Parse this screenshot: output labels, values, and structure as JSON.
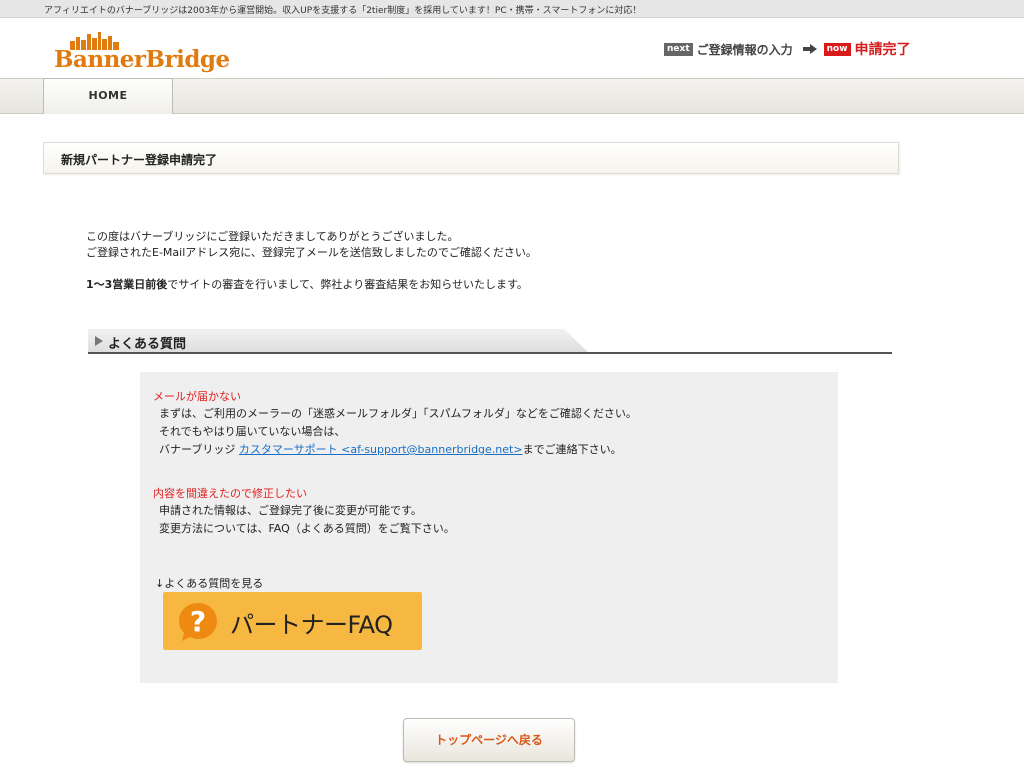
{
  "topbar": {
    "notice": "アフィリエイトのバナーブリッジは2003年から運営開始。収入UPを支援する「2tier制度」を採用しています！PC・携帯・スマートフォンに対応！"
  },
  "header": {
    "logo_text": "BannerBridge",
    "steps": {
      "next_badge": "next",
      "next_label": "ご登録情報の入力",
      "now_badge": "now",
      "now_label": "申請完了"
    }
  },
  "nav": {
    "home": "HOME"
  },
  "page": {
    "title": "新規パートナー登録申請完了"
  },
  "intro": {
    "line1": "この度はバナーブリッジにご登録いただきましてありがとうございました。",
    "line2": "ご登録されたE-Mailアドレス宛に、登録完了メールを送信致しましたのでご確認ください。",
    "notice_bold": "1～3営業日前後",
    "notice_rest": "でサイトの審査を行いまして、弊社より審査結果をお知らせいたします。"
  },
  "faq": {
    "heading": "よくある質問",
    "items": [
      {
        "question": "メールが届かない",
        "answer1": "まずは、ご利用のメーラーの「迷惑メールフォルダ」「スパムフォルダ」などをご確認ください。",
        "answer2": "それでもやはり届いていない場合は、",
        "answer3_pre": "バナーブリッジ ",
        "answer3_link": "カスタマーサポート <af-support@bannerbridge.net>",
        "answer3_post": "までご連絡下さい。"
      },
      {
        "question": "内容を間違えたので修正したい",
        "answer1": "申請された情報は、ご登録完了後に変更が可能です。",
        "answer2": "変更方法については、FAQ（よくある質問）をご覧下さい。"
      }
    ],
    "see_more": "↓よくある質問を見る",
    "banner_text": "パートナーFAQ",
    "banner_mark": "?"
  },
  "footer": {
    "back_button": "トップページへ戻る"
  },
  "colors": {
    "accent_orange": "#e07b10",
    "alert_red": "#d71a1a",
    "link_blue": "#1a6fc4",
    "faq_banner": "#f7b842"
  }
}
